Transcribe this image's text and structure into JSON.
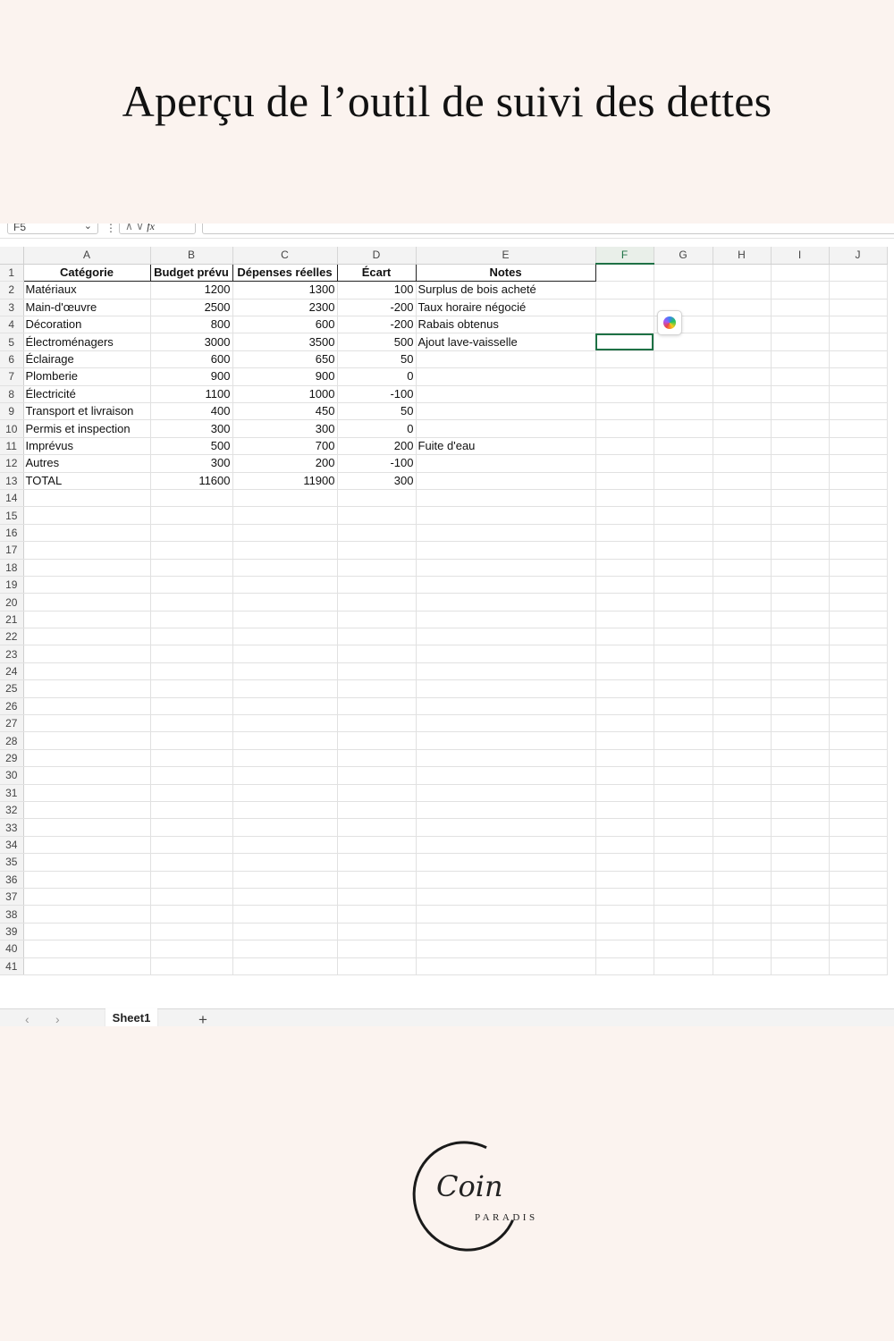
{
  "page": {
    "title": "Aperçu de l’outil de suivi des dettes"
  },
  "formula_bar": {
    "name_box": "F5",
    "fx": "fx"
  },
  "columns": [
    "A",
    "B",
    "C",
    "D",
    "E",
    "F",
    "G",
    "H",
    "I",
    "J"
  ],
  "active_cell": "F5",
  "table": {
    "headers": [
      "Catégorie",
      "Budget prévu",
      "Dépenses réelles",
      "Écart",
      "Notes"
    ],
    "rows": [
      [
        "Matériaux",
        "1200",
        "1300",
        "100",
        "Surplus de bois acheté"
      ],
      [
        "Main-d'œuvre",
        "2500",
        "2300",
        "-200",
        "Taux horaire négocié"
      ],
      [
        "Décoration",
        "800",
        "600",
        "-200",
        "Rabais obtenus"
      ],
      [
        "Électroménagers",
        "3000",
        "3500",
        "500",
        "Ajout lave-vaisselle"
      ],
      [
        "Éclairage",
        "600",
        "650",
        "50",
        ""
      ],
      [
        "Plomberie",
        "900",
        "900",
        "0",
        ""
      ],
      [
        "Électricité",
        "1100",
        "1000",
        "-100",
        ""
      ],
      [
        "Transport et livraison",
        "400",
        "450",
        "50",
        ""
      ],
      [
        "Permis et inspection",
        "300",
        "300",
        "0",
        ""
      ],
      [
        "Imprévus",
        "500",
        "700",
        "200",
        "Fuite d'eau"
      ],
      [
        "Autres",
        "300",
        "200",
        "-100",
        ""
      ],
      [
        "TOTAL",
        "11600",
        "11900",
        "300",
        ""
      ]
    ]
  },
  "total_rows": 41,
  "sheet_tabs": {
    "active": "Sheet1",
    "add": "+"
  },
  "icons": {
    "prev": "chevron-left-icon",
    "next": "chevron-right-icon",
    "copilot": "copilot-icon"
  },
  "colors": {
    "background": "#fbf3ef",
    "accent": "#1e7145"
  },
  "logo": {
    "script": "Coin",
    "sub": "PARADIS"
  }
}
